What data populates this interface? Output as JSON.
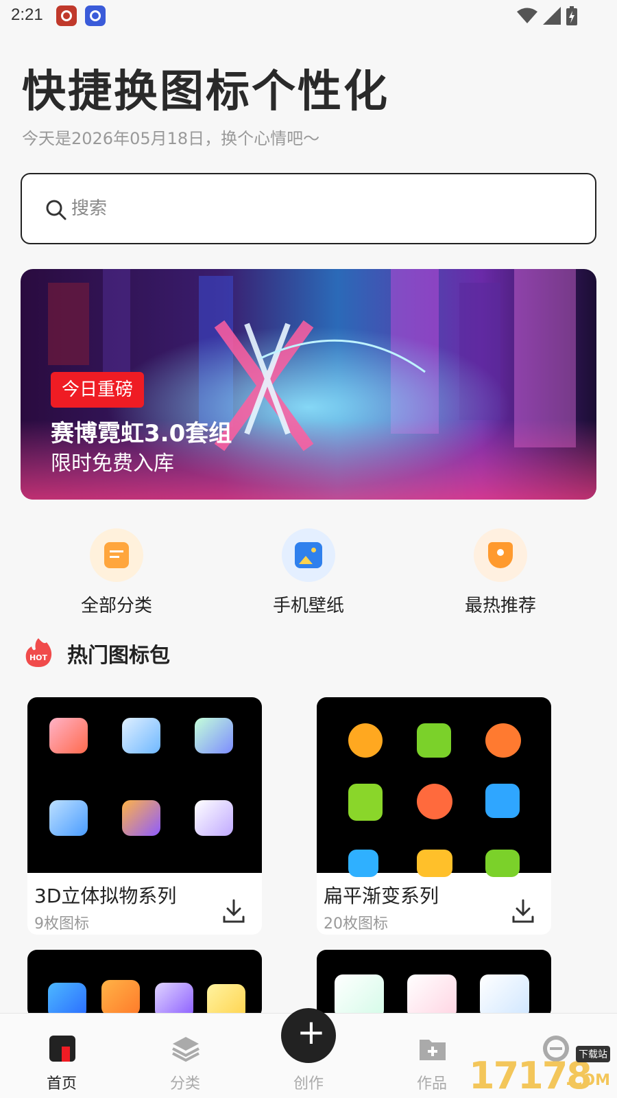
{
  "status": {
    "time": "2:21"
  },
  "header": {
    "title": "快捷换图标个性化",
    "subtitle": "今天是2026年05月18日，换个心情吧～"
  },
  "search": {
    "placeholder": "搜索",
    "value": ""
  },
  "banner": {
    "tag": "今日重磅",
    "title": "赛博霓虹3.0套组",
    "subtitle": "限时免费入库"
  },
  "quick_entries": [
    {
      "label": "全部分类",
      "icon": "clipboard-icon",
      "color": "#ffa63d"
    },
    {
      "label": "手机壁纸",
      "icon": "image-icon",
      "color": "#2f80ed"
    },
    {
      "label": "最热推荐",
      "icon": "trophy-icon",
      "color": "#ff9a2e"
    }
  ],
  "section": {
    "title": "热门图标包",
    "badge": "HOT"
  },
  "packs": [
    {
      "name": "3D立体拟物系列",
      "count": "9枚图标"
    },
    {
      "name": "扁平渐变系列",
      "count": "20枚图标"
    }
  ],
  "bottom_nav": [
    {
      "label": "首页",
      "icon": "home-icon",
      "active": true
    },
    {
      "label": "分类",
      "icon": "layers-icon",
      "active": false
    },
    {
      "label": "创作",
      "icon": "plus-icon",
      "active": false
    },
    {
      "label": "作品",
      "icon": "folder-plus-icon",
      "active": false
    },
    {
      "label": "",
      "icon": "profile-icon",
      "active": false
    }
  ],
  "watermark": {
    "text": "17178",
    "suffix": ".COM",
    "badge": "下载站"
  },
  "colors": {
    "accent": "#ef1c24",
    "text": "#222222",
    "muted": "#999999"
  }
}
